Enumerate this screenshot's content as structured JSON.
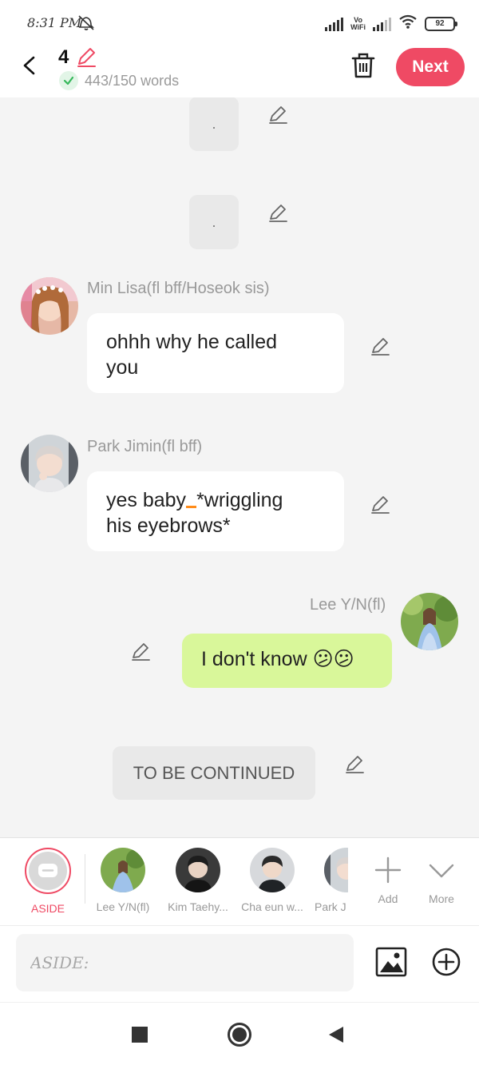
{
  "status_bar": {
    "time": "8:31 PM",
    "vo_label": "Vo",
    "wifi_label": "WiFi",
    "battery": "92"
  },
  "header": {
    "episode_number": "4",
    "word_count": "443/150 words",
    "next_label": "Next"
  },
  "chat": {
    "messages": [
      {
        "type": "aside",
        "text": "."
      },
      {
        "type": "aside",
        "text": "."
      },
      {
        "type": "left",
        "speaker": "Min Lisa(fl bff/Hoseok sis)",
        "text_line1": "ohhh why he called",
        "text_line2": "you"
      },
      {
        "type": "left",
        "speaker": "Park Jimin(fl bff)",
        "text_line1_a": "yes baby",
        "text_line1_b": "*wriggling",
        "text_line2": "his eyebrows*"
      },
      {
        "type": "right",
        "speaker": "Lee Y/N(fl)",
        "text": "I don't know 😕😕"
      },
      {
        "type": "aside",
        "text": "TO BE CONTINUED"
      }
    ]
  },
  "character_picker": {
    "aside_label": "ASIDE",
    "characters": [
      {
        "label": "Lee Y/N(fl)"
      },
      {
        "label": "Kim Taehy..."
      },
      {
        "label": "Cha eun w..."
      },
      {
        "label": "Park J"
      }
    ],
    "add_label": "Add",
    "more_label": "More"
  },
  "composer": {
    "placeholder": "ASIDE:"
  },
  "colors": {
    "accent": "#ef4a64",
    "my_bubble": "#d9f79a",
    "check_green": "#35b85a"
  }
}
